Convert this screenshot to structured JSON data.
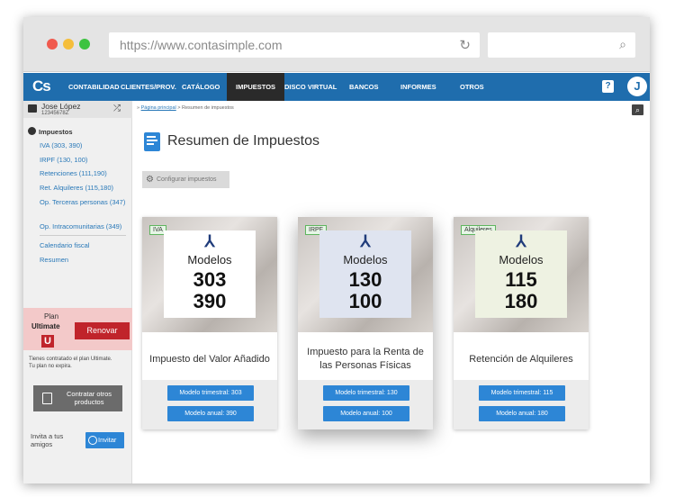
{
  "browser": {
    "url": "https://www.contasimple.com"
  },
  "nav": {
    "logo": "Cs",
    "items": [
      "CONTABILIDAD",
      "CLIENTES/PROV.",
      "CATÁLOGO",
      "IMPUESTOS",
      "DISCO VIRTUAL",
      "BANCOS",
      "INFORMES",
      "OTROS"
    ],
    "active": "IMPUESTOS",
    "help": "?",
    "user_initial": "J"
  },
  "user": {
    "name": "Jose López",
    "id": "12345678Z"
  },
  "sidebar": {
    "heading": "Impuestos",
    "links": [
      "IVA (303, 390)",
      "IRPF (130, 100)",
      "Retenciones (111,190)",
      "Ret. Alquileres (115,180)",
      "Op. Terceras personas (347)",
      "Op. Intracomunitarias (349)"
    ],
    "extra_links": [
      "Calendario fiscal",
      "Resumen"
    ],
    "plan_label": "Plan",
    "plan_name": "Ultimate",
    "plan_badge": "U",
    "renew": "Renovar",
    "plan_note_1": "Tienes contratado el plan Ultimate.",
    "plan_note_2": "Tu plan no expira.",
    "contract_1": "Contratar otros",
    "contract_2": "productos",
    "invite_1": "Invita a tus",
    "invite_2": "amigos",
    "invite_button": "Invitar"
  },
  "breadcrumb": {
    "home": "Página principal",
    "sep": ">",
    "current": "Resumen de impuestos"
  },
  "page": {
    "title": "Resumen de Impuestos",
    "config_button": "Configurar impuestos"
  },
  "colors": {
    "nav": "#1f6dad",
    "button": "#2d86d6",
    "renew": "#c0242b"
  },
  "cards": [
    {
      "tag": "IVA",
      "modelos": "Modelos",
      "n1": "303",
      "n2": "390",
      "name": "Impuesto del Valor Añadido",
      "btn1": "Modelo trimestral: 303",
      "btn2": "Modelo anual: 390",
      "panel_color": "#ffffff"
    },
    {
      "tag": "IRPF",
      "modelos": "Modelos",
      "n1": "130",
      "n2": "100",
      "name": "Impuesto para la Renta de las Personas Físicas",
      "btn1": "Modelo trimestral: 130",
      "btn2": "Modelo anual: 100",
      "panel_color": "#dfe4f0"
    },
    {
      "tag": "Alquileres",
      "modelos": "Modelos",
      "n1": "115",
      "n2": "180",
      "name": "Retención de Alquileres",
      "btn1": "Modelo trimestral: 115",
      "btn2": "Modelo anual: 180",
      "panel_color": "#eef2e2"
    }
  ]
}
